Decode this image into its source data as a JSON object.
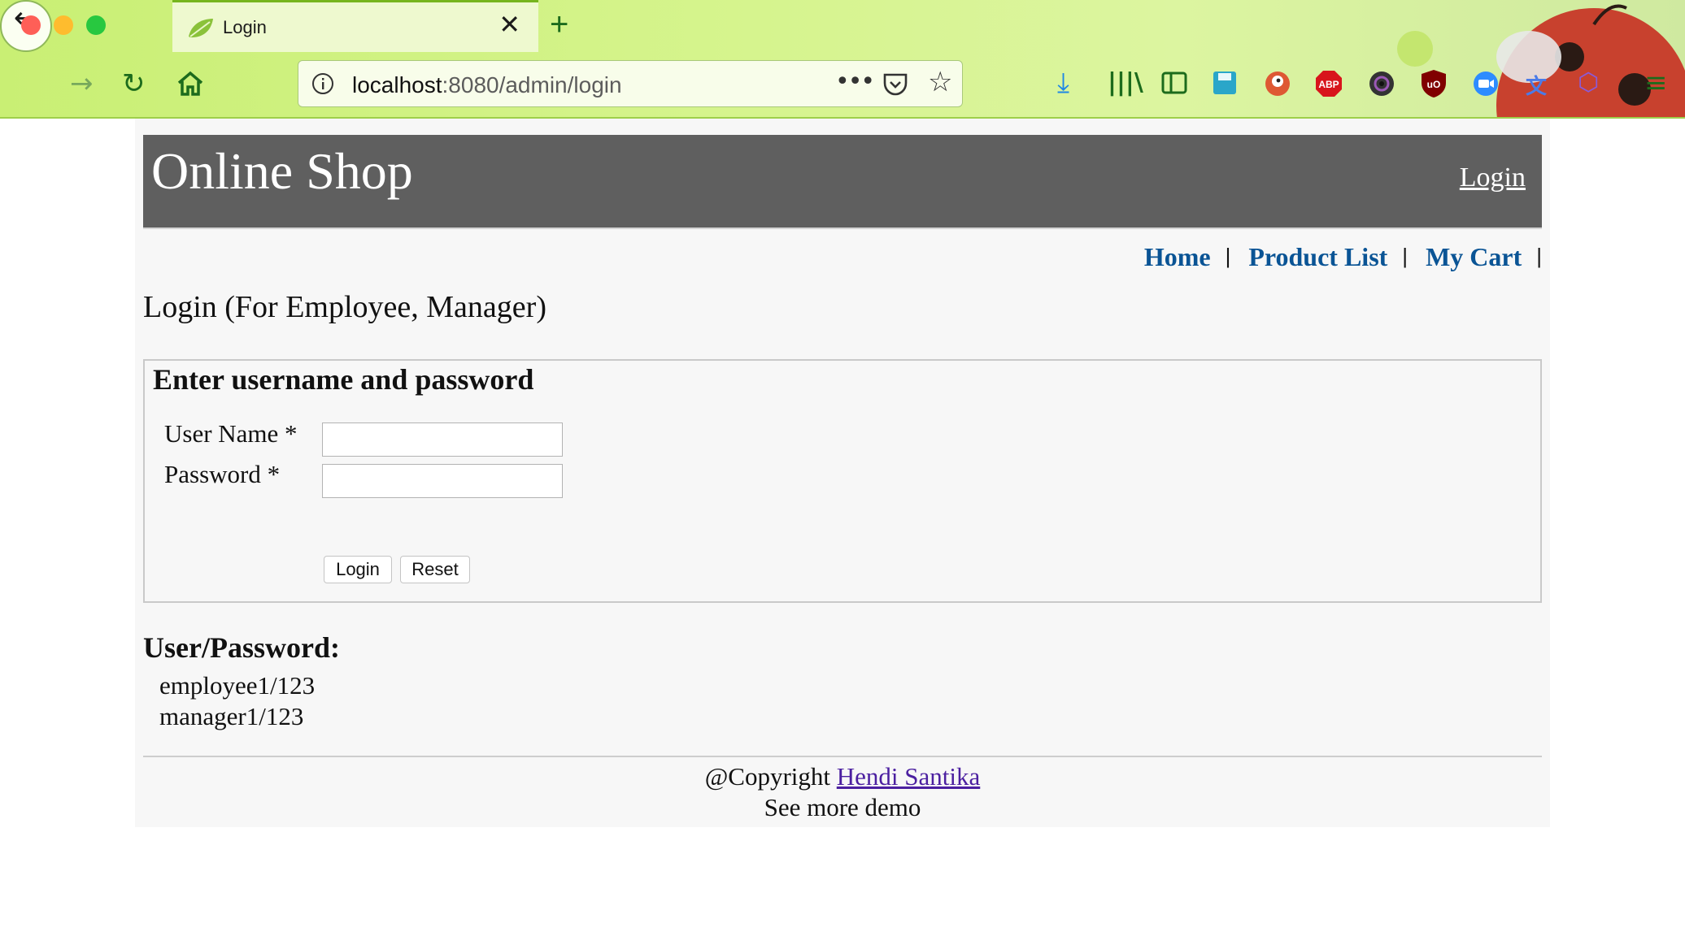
{
  "browser": {
    "tab": {
      "title": "Login",
      "close_glyph": "✕",
      "favicon": "spring-leaf-icon"
    },
    "new_tab_glyph": "+",
    "url": {
      "host": "localhost",
      "rest": ":8080/admin/login"
    },
    "icons": [
      "back-icon",
      "forward-icon",
      "reload-icon",
      "home-icon",
      "info-icon",
      "more-icon",
      "pocket-icon",
      "bookmark-star-icon",
      "download-icon",
      "library-icon",
      "reader-icon",
      "save-icon",
      "duckduckgo-icon",
      "adblock-icon",
      "camera-icon",
      "ublock-icon",
      "zoom-icon",
      "translate-icon",
      "extension-icon",
      "menu-icon"
    ],
    "abp_label": "ABP",
    "ublock_label": "uO"
  },
  "colors": {
    "chrome_bg": "#d6f48e",
    "header_bg": "#5f5f5f",
    "link_blue": "#0a5495",
    "visited_link": "#4b1fa0"
  },
  "header": {
    "title": "Online Shop",
    "login_link": "Login"
  },
  "menu": {
    "items": [
      "Home",
      "Product List",
      "My Cart"
    ],
    "separator": "|"
  },
  "page": {
    "heading": "Login (For Employee, Manager)",
    "form": {
      "heading": "Enter username and password",
      "username_label": "User Name *",
      "password_label": "Password *",
      "username_value": "",
      "password_value": "",
      "login_button": "Login",
      "reset_button": "Reset"
    },
    "credentials": {
      "heading": "User/Password:",
      "items": [
        "employee1/123",
        "manager1/123"
      ]
    }
  },
  "footer": {
    "copyright_prefix": "@Copyright",
    "author": "Hendi Santika",
    "demo": "See more demo"
  }
}
